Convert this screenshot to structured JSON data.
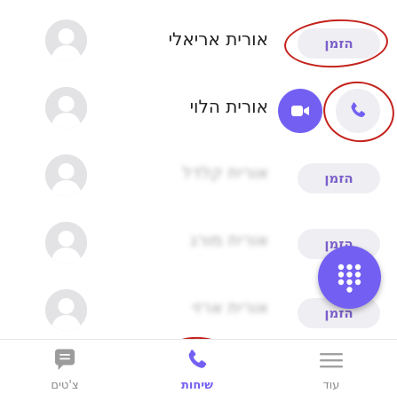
{
  "contacts": [
    {
      "name": "אורית אריאלי",
      "invite_label": "הזמן"
    },
    {
      "name": "אורית הלוי"
    },
    {
      "name": "אורית קלדל",
      "invite_label": "הזמן"
    },
    {
      "name": "אורית מורג",
      "invite_label": "הזמן"
    },
    {
      "name": "אורית ארזי",
      "invite_label": "הזמן"
    }
  ],
  "tabs": {
    "more": {
      "label": "עוד",
      "icon": "menu-icon"
    },
    "calls": {
      "label": "שיחות",
      "icon": "phone-icon"
    },
    "chats": {
      "label": "צ'טים",
      "icon": "chat-bubble-icon"
    }
  },
  "colors": {
    "accent": "#7360f2",
    "invite_text": "#7b60c9",
    "annotation": "#c4221c"
  }
}
